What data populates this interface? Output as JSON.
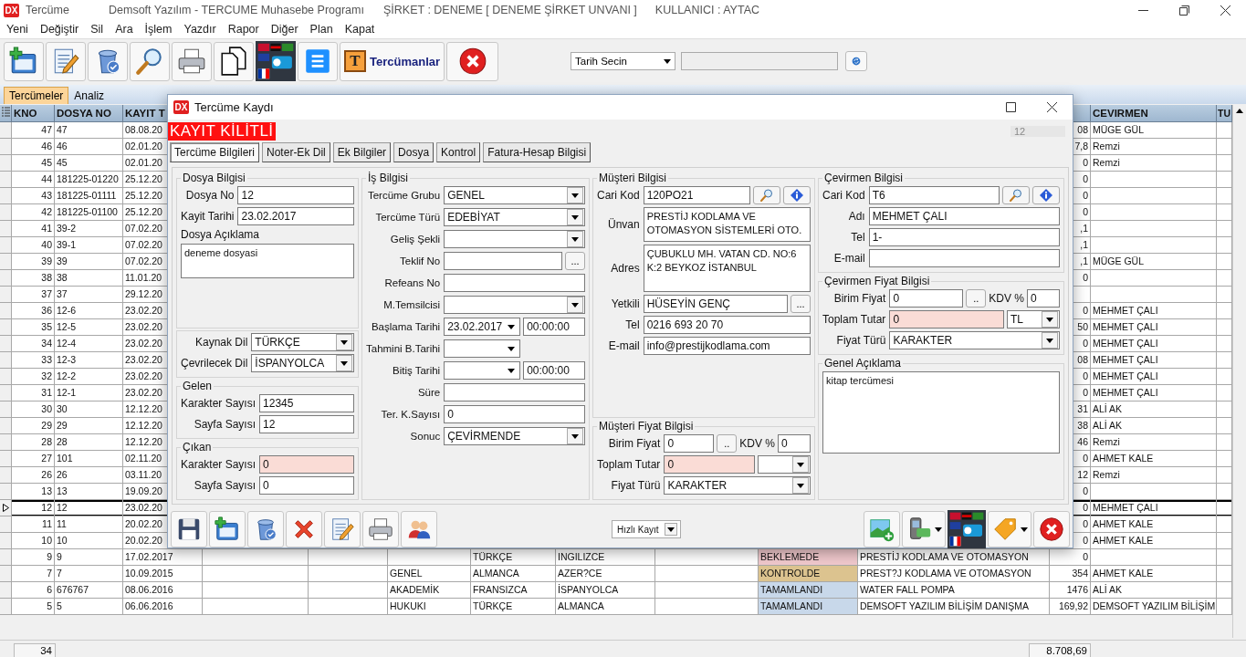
{
  "window": {
    "logo": "DX",
    "title": "Tercüme",
    "app_title": "Demsoft Yazılım - TERCUME Muhasebe Programı",
    "company": "ŞİRKET : DENEME [ DENEME ŞİRKET UNVANI ]",
    "user": "KULLANICI : AYTAC"
  },
  "menu": [
    "Yeni",
    "Değiştir",
    "Sil",
    "Ara",
    "İşlem",
    "Yazdır",
    "Rapor",
    "Diğer",
    "Plan",
    "Kapat"
  ],
  "toolbar": [
    {
      "kind": "new"
    },
    {
      "kind": "edit"
    },
    {
      "kind": "delete"
    },
    {
      "kind": "search"
    },
    {
      "kind": "print"
    },
    {
      "kind": "copy"
    },
    {
      "kind": "flags"
    },
    {
      "kind": "list"
    },
    {
      "kind": "translators",
      "glyph": "T",
      "label": "Tercümanlar"
    },
    {
      "kind": "close"
    }
  ],
  "date_filter": {
    "value": "Tarih Secin"
  },
  "tabs": [
    {
      "label": "Tercümeler",
      "selected": true
    },
    {
      "label": "Analiz",
      "selected": false
    }
  ],
  "grid": {
    "columns": {
      "kno": "KNO",
      "dosya_no": "DOSYA NO",
      "column_3": "KAYIT T",
      "cevirmen": "CEVIRMEN",
      "column_14": "TU"
    },
    "rows": [
      {
        "selected": false,
        "kno": "47",
        "dosya_no": "47",
        "column_3": "08.08.20",
        "column_12": "08",
        "cevirmen": "MÜGE GÜL"
      },
      {
        "selected": false,
        "kno": "46",
        "dosya_no": "46",
        "column_3": "02.01.20",
        "column_12": "7,8",
        "cevirmen": "Remzi"
      },
      {
        "selected": false,
        "kno": "45",
        "dosya_no": "45",
        "column_3": "02.01.20",
        "column_12": "0",
        "cevirmen": "Remzi"
      },
      {
        "selected": false,
        "kno": "44",
        "dosya_no": "181225-01220",
        "column_3": "25.12.20",
        "column_12": "0"
      },
      {
        "selected": false,
        "kno": "43",
        "dosya_no": "181225-01111",
        "column_3": "25.12.20",
        "column_12": "0"
      },
      {
        "selected": false,
        "kno": "42",
        "dosya_no": "181225-01100",
        "column_3": "25.12.20",
        "column_12": "0"
      },
      {
        "selected": false,
        "kno": "41",
        "dosya_no": "39-2",
        "column_3": "07.02.20",
        "column_12": ",1"
      },
      {
        "selected": false,
        "kno": "40",
        "dosya_no": "39-1",
        "column_3": "07.02.20",
        "column_12": ",1"
      },
      {
        "selected": false,
        "kno": "39",
        "dosya_no": "39",
        "column_3": "07.02.20",
        "column_12": ",1",
        "cevirmen": "MÜGE GÜL"
      },
      {
        "selected": false,
        "kno": "38",
        "dosya_no": "38",
        "column_3": "11.01.20",
        "column_12": "0"
      },
      {
        "selected": false,
        "kno": "37",
        "dosya_no": "37",
        "column_3": "29.12.20"
      },
      {
        "selected": false,
        "kno": "36",
        "dosya_no": "12-6",
        "column_3": "23.02.20",
        "column_12": "0",
        "cevirmen": "MEHMET ÇALI"
      },
      {
        "selected": false,
        "kno": "35",
        "dosya_no": "12-5",
        "column_3": "23.02.20",
        "column_12": "50",
        "cevirmen": "MEHMET ÇALI"
      },
      {
        "selected": false,
        "kno": "34",
        "dosya_no": "12-4",
        "column_3": "23.02.20",
        "column_12": "0",
        "cevirmen": "MEHMET ÇALI"
      },
      {
        "selected": false,
        "kno": "33",
        "dosya_no": "12-3",
        "column_3": "23.02.20",
        "column_12": "08",
        "cevirmen": "MEHMET ÇALI"
      },
      {
        "selected": false,
        "kno": "32",
        "dosya_no": "12-2",
        "column_3": "23.02.20",
        "column_12": "0",
        "cevirmen": "MEHMET ÇALI"
      },
      {
        "selected": false,
        "kno": "31",
        "dosya_no": "12-1",
        "column_3": "23.02.20",
        "column_12": "0",
        "cevirmen": "MEHMET ÇALI"
      },
      {
        "selected": false,
        "kno": "30",
        "dosya_no": "30",
        "column_3": "12.12.20",
        "column_12": "31",
        "cevirmen": "ALİ AK"
      },
      {
        "selected": false,
        "kno": "29",
        "dosya_no": "29",
        "column_3": "12.12.20",
        "column_12": "38",
        "cevirmen": "ALİ AK"
      },
      {
        "selected": false,
        "kno": "28",
        "dosya_no": "28",
        "column_3": "12.12.20",
        "column_12": "46",
        "cevirmen": "Remzi"
      },
      {
        "selected": false,
        "kno": "27",
        "dosya_no": "101",
        "column_3": "02.11.20",
        "column_12": "0",
        "cevirmen": "AHMET KALE"
      },
      {
        "selected": false,
        "kno": "26",
        "dosya_no": "26",
        "column_3": "03.11.20",
        "column_12": "12",
        "cevirmen": "Remzi"
      },
      {
        "selected": false,
        "kno": "13",
        "dosya_no": "13",
        "column_3": "19.09.20",
        "column_12": "0"
      },
      {
        "selected": true,
        "kno": "12",
        "dosya_no": "12",
        "column_3": "23.02.20",
        "column_12": "0",
        "cevirmen": "MEHMET ÇALI"
      },
      {
        "selected": false,
        "kno": "11",
        "dosya_no": "11",
        "column_3": "20.02.20",
        "column_12": "0",
        "cevirmen": "AHMET KALE"
      },
      {
        "selected": false,
        "kno": "10",
        "dosya_no": "10",
        "column_3": "20.02.20",
        "column_12": "0",
        "cevirmen": "AHMET KALE"
      },
      {
        "selected": false,
        "kno": "9",
        "dosya_no": "9",
        "column_3": "17.02.2017",
        "column_7": "TÜRKÇE",
        "column_8": "INGILIZCE",
        "column_10": "BEKLEMEDE",
        "color": "#f0c8cc",
        "column_11": "PRESTİJ KODLAMA VE OTOMASYON",
        "column_12": "0"
      },
      {
        "selected": false,
        "kno": "7",
        "dosya_no": "7",
        "column_3": "10.09.2015",
        "column_6": "GENEL",
        "column_7": "ALMANCA",
        "column_8": "AZER?CE",
        "column_10": "KONTROLDE",
        "color": "#dcc38f",
        "column_11": "PREST?J KODLAMA VE OTOMASYON",
        "column_12": "354",
        "cevirmen": "AHMET KALE"
      },
      {
        "selected": false,
        "kno": "6",
        "dosya_no": "676767",
        "column_3": "08.06.2016",
        "column_6": "AKADEMİK",
        "column_7": "FRANSIZCA",
        "column_8": "İSPANYOLCA",
        "column_10": "TAMAMLANDI",
        "color": "#c8d8ea",
        "column_11": "WATER FALL POMPA",
        "column_12": "1476",
        "cevirmen": "ALİ AK"
      },
      {
        "selected": false,
        "kno": "5",
        "dosya_no": "5",
        "column_3": "06.06.2016",
        "column_6": "HUKUKI",
        "column_7": "TÜRKÇE",
        "column_8": "ALMANCA",
        "column_10": "TAMAMLANDI",
        "color": "#c8d8ea",
        "column_11": "DEMSOFT YAZILIM BİLİŞİM DANIŞMA",
        "column_12": "169,92",
        "cevirmen": "DEMSOFT YAZILIM BİLİŞİM"
      }
    ]
  },
  "footer": {
    "count": "34",
    "total": "8.708,69"
  },
  "dialog": {
    "logo": "DX",
    "title": "Tercüme Kaydı",
    "lock_banner": "KAYIT KİLİTLİ",
    "record_no": "12",
    "tabs": [
      {
        "label": "Tercüme Bilgileri",
        "selected": true
      },
      {
        "label": "Noter-Ek Dil",
        "selected": false
      },
      {
        "label": "Ek Bilgiler",
        "selected": false
      },
      {
        "label": "Dosya",
        "selected": false
      },
      {
        "label": "Kontrol",
        "selected": false
      },
      {
        "label": "Fatura-Hesap Bilgisi",
        "selected": false
      }
    ],
    "columns": [
      [
        {
          "title": "Dosya Bilgisi",
          "rows": [
            {
              "label": "Dosya No",
              "controls": [
                {
                  "kind": "text",
                  "value": "12",
                  "highlighted": false
                }
              ]
            },
            {
              "label": "Kayit Tarihi",
              "controls": [
                {
                  "kind": "text",
                  "value": "23.02.2017",
                  "highlighted": false
                }
              ]
            },
            {
              "controls": [
                {
                  "kind": "caption",
                  "text": "Dosya Açıklama"
                }
              ]
            },
            {
              "controls": [
                {
                  "kind": "memo",
                  "lines": [
                    "deneme dosyasi"
                  ]
                }
              ]
            }
          ]
        },
        {
          "rows": [
            {
              "label": "Kaynak Dil",
              "controls": [
                {
                  "kind": "combo",
                  "value": "TÜRKÇE"
                }
              ]
            },
            {
              "label": "Çevrilecek Dil",
              "controls": [
                {
                  "kind": "combo",
                  "value": "İSPANYOLCA"
                }
              ]
            }
          ]
        },
        {
          "title": "Gelen",
          "rows": [
            {
              "label": "Karakter Sayısı",
              "controls": [
                {
                  "kind": "text",
                  "value": "12345",
                  "highlighted": false
                }
              ]
            },
            {
              "label": "Sayfa Sayısı",
              "controls": [
                {
                  "kind": "text",
                  "value": "12",
                  "highlighted": false
                }
              ]
            }
          ]
        },
        {
          "title": "Çıkan",
          "rows": [
            {
              "label": "Karakter Sayısı",
              "controls": [
                {
                  "kind": "text",
                  "value": "0",
                  "highlighted": true
                }
              ]
            },
            {
              "label": "Sayfa Sayısı",
              "controls": [
                {
                  "kind": "text",
                  "value": "0",
                  "highlighted": false
                }
              ]
            }
          ]
        }
      ],
      [
        {
          "title": "İş Bilgisi",
          "rows": [
            {
              "label": "Tercüme Grubu",
              "controls": [
                {
                  "kind": "combo",
                  "value": "GENEL"
                }
              ]
            },
            {
              "label": "Tercüme Türü",
              "controls": [
                {
                  "kind": "combo",
                  "value": "EDEBİYAT"
                }
              ]
            },
            {
              "label": "Geliş Şekli",
              "controls": [
                {
                  "kind": "combo"
                }
              ]
            },
            {
              "label": "Teklif No",
              "controls": [
                {
                  "kind": "text",
                  "highlighted": false
                },
                {
                  "kind": "button",
                  "label": "..."
                }
              ]
            },
            {
              "label": "Refeans No",
              "controls": [
                {
                  "kind": "text",
                  "highlighted": false
                }
              ]
            },
            {
              "label": "M.Temsilcisi",
              "controls": [
                {
                  "kind": "combo"
                }
              ]
            },
            {
              "label": "Başlama Tarihi",
              "controls": [
                {
                  "kind": "date",
                  "value": "23.02.2017"
                },
                {
                  "kind": "text",
                  "value": "00:00:00",
                  "highlighted": false
                }
              ]
            },
            {
              "label": "Tahmini B.Tarihi",
              "controls": [
                {
                  "kind": "date"
                }
              ]
            },
            {
              "label": "Bitiş Tarihi",
              "controls": [
                {
                  "kind": "date"
                },
                {
                  "kind": "text",
                  "value": "00:00:00",
                  "highlighted": false
                }
              ]
            },
            {
              "label": "Süre",
              "controls": [
                {
                  "kind": "text",
                  "highlighted": false
                }
              ]
            },
            {
              "label": "Ter. K.Sayısı",
              "controls": [
                {
                  "kind": "text",
                  "value": "0",
                  "highlighted": false
                }
              ]
            },
            {
              "label": "Sonuc",
              "controls": [
                {
                  "kind": "combo",
                  "value": "ÇEVİRMENDE"
                }
              ]
            }
          ]
        }
      ],
      [
        {
          "title": "Müşteri Bilgisi",
          "rows": [
            {
              "label": "Cari Kod",
              "controls": [
                {
                  "kind": "text",
                  "value": "120PO21",
                  "highlighted": false
                },
                {
                  "kind": "search-button"
                },
                {
                  "kind": "info-button"
                }
              ]
            },
            {
              "label": "Ünvan",
              "controls": [
                {
                  "kind": "memo",
                  "lines": [
                    "PRESTİJ KODLAMA VE",
                    "OTOMASYON SİSTEMLERİ OTO."
                  ]
                }
              ]
            },
            {
              "label": "Adres",
              "controls": [
                {
                  "kind": "memo",
                  "lines": [
                    "ÇUBUKLU MH. VATAN CD. NO:6",
                    "K:2 BEYKOZ İSTANBUL"
                  ]
                }
              ]
            },
            {
              "label": "Yetkili",
              "controls": [
                {
                  "kind": "text",
                  "value": "HÜSEYİN GENÇ",
                  "highlighted": false
                },
                {
                  "kind": "button",
                  "label": "..."
                }
              ]
            },
            {
              "label": "Tel",
              "controls": [
                {
                  "kind": "text",
                  "value": "0216 693 20 70",
                  "highlighted": false
                }
              ]
            },
            {
              "label": "E-mail",
              "controls": [
                {
                  "kind": "text",
                  "value": "info@prestijkodlama.com",
                  "highlighted": false
                }
              ]
            }
          ]
        },
        {
          "title": "Müşteri Fiyat Bilgisi",
          "rows": [
            {
              "label": "Birim Fiyat",
              "controls": [
                {
                  "kind": "text",
                  "value": "0",
                  "highlighted": false
                },
                {
                  "kind": "button",
                  "label": ".."
                },
                {
                  "kind": "caption",
                  "text": "KDV %"
                },
                {
                  "kind": "text",
                  "value": "0",
                  "highlighted": false
                }
              ]
            },
            {
              "label": "Toplam Tutar",
              "controls": [
                {
                  "kind": "text",
                  "value": "0",
                  "highlighted": true
                },
                {
                  "kind": "combo"
                }
              ]
            },
            {
              "label": "Fiyat Türü",
              "controls": [
                {
                  "kind": "combo",
                  "value": "KARAKTER"
                }
              ]
            }
          ]
        }
      ],
      [
        {
          "title": "Çevirmen Bilgisi",
          "rows": [
            {
              "label": "Cari Kod",
              "controls": [
                {
                  "kind": "text",
                  "value": "T6",
                  "highlighted": false
                },
                {
                  "kind": "search-button"
                },
                {
                  "kind": "info-button"
                }
              ]
            },
            {
              "label": "Adı",
              "controls": [
                {
                  "kind": "text",
                  "value": "MEHMET ÇALI",
                  "highlighted": false
                }
              ]
            },
            {
              "label": "Tel",
              "controls": [
                {
                  "kind": "text",
                  "value": "1-",
                  "highlighted": false
                }
              ]
            },
            {
              "label": "E-mail",
              "controls": [
                {
                  "kind": "text",
                  "highlighted": false
                }
              ]
            }
          ]
        },
        {
          "title": "Çevirmen Fiyat Bilgisi",
          "rows": [
            {
              "label": "Birim Fiyat",
              "controls": [
                {
                  "kind": "text",
                  "value": "0",
                  "highlighted": false
                },
                {
                  "kind": "button",
                  "label": ".."
                },
                {
                  "kind": "caption",
                  "text": "KDV %"
                },
                {
                  "kind": "text",
                  "value": "0",
                  "highlighted": false
                }
              ]
            },
            {
              "label": "Toplam Tutar",
              "controls": [
                {
                  "kind": "text",
                  "value": "0",
                  "highlighted": true
                },
                {
                  "kind": "combo",
                  "value": "TL"
                }
              ]
            },
            {
              "label": "Fiyat Türü",
              "controls": [
                {
                  "kind": "combo",
                  "value": "KARAKTER"
                }
              ]
            }
          ]
        },
        {
          "title": "Genel Açıklama",
          "rows": [
            {
              "controls": [
                {
                  "kind": "memo",
                  "lines": [
                    "kitap tercümesi"
                  ]
                }
              ]
            }
          ]
        }
      ]
    ],
    "left_buttons": [
      {
        "kind": "save"
      },
      {
        "kind": "new"
      },
      {
        "kind": "delete"
      },
      {
        "kind": "cancel"
      },
      {
        "kind": "edit"
      },
      {
        "kind": "print"
      },
      {
        "kind": "users"
      }
    ],
    "quick_save": {
      "value": "Hızlı Kayıt"
    },
    "right_buttons": [
      {
        "kind": "image-add",
        "menu": false
      },
      {
        "kind": "sms",
        "menu": true
      },
      {
        "kind": "flags",
        "menu": false
      },
      {
        "kind": "tag",
        "menu": true
      },
      {
        "kind": "close",
        "menu": false
      }
    ]
  }
}
